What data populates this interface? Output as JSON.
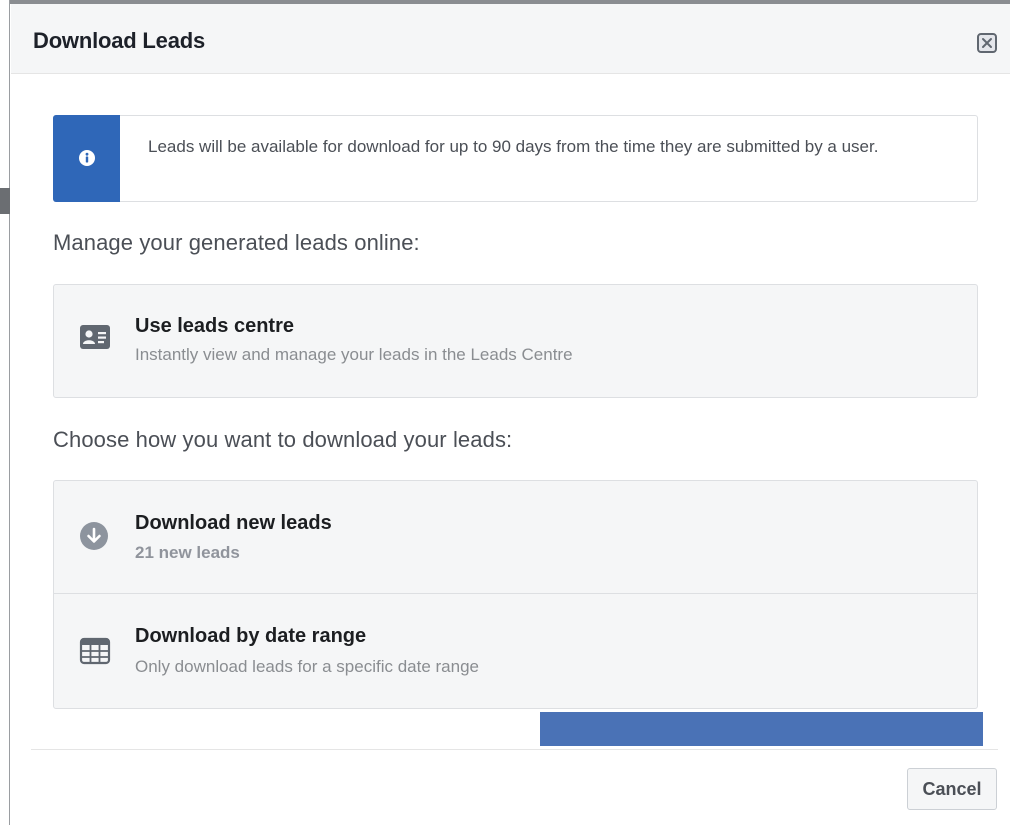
{
  "dialog": {
    "title": "Download Leads",
    "close_icon": "close-icon"
  },
  "info": {
    "icon": "info-icon",
    "text": "Leads will be available for download for up to 90 days from the time they are submitted by a user."
  },
  "manage_section": {
    "label": "Manage your generated leads online:",
    "option": {
      "icon": "contact-card-icon",
      "title": "Use leads centre",
      "subtitle": "Instantly view and manage your leads in the Leads Centre"
    }
  },
  "download_section": {
    "label": "Choose how you want to download your leads:",
    "options": [
      {
        "icon": "download-arrow-icon",
        "title": "Download new leads",
        "subtitle": "21 new leads"
      },
      {
        "icon": "calendar-grid-icon",
        "title": "Download by date range",
        "subtitle": "Only download leads for a specific date range"
      }
    ]
  },
  "footer": {
    "cancel_label": "Cancel"
  },
  "colors": {
    "accent_blue": "#2f67b8",
    "highlight_bar": "#4a72b6",
    "header_bg": "#f5f6f7"
  }
}
